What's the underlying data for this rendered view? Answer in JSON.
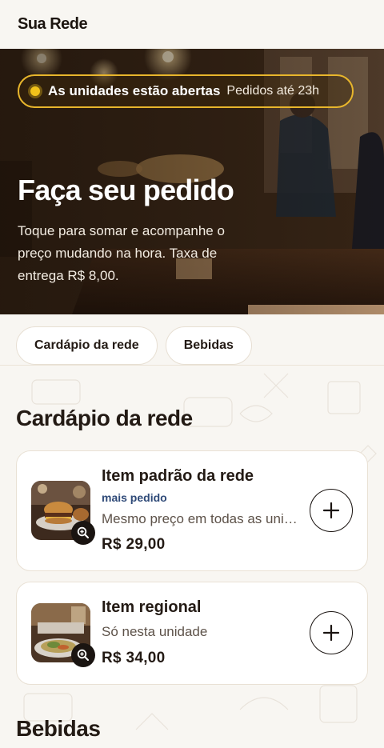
{
  "header": {
    "brand": "Sua Rede"
  },
  "hero": {
    "status_strong": "As unidades estão abertas",
    "status_soft": "Pedidos até 23h",
    "title": "Faça seu pedido",
    "description": "Toque para somar e acompanhe o preço mudando na hora. Taxa de entrega R$ 8,00.",
    "image": "bakery-counter-photo"
  },
  "tabs": [
    {
      "label": "Cardápio da rede"
    },
    {
      "label": "Bebidas"
    }
  ],
  "sections": [
    {
      "title": "Cardápio da rede",
      "items": [
        {
          "name": "Item padrão da rede",
          "tag": "mais pedido",
          "description": "Mesmo preço em todas as unidades",
          "price": "R$ 29,00",
          "image": "burger-photo",
          "zoom_icon": "zoom-in-icon",
          "add_icon": "plus-icon"
        },
        {
          "name": "Item regional",
          "tag": "",
          "description": "Só nesta unidade",
          "price": "R$ 34,00",
          "image": "dish-photo",
          "zoom_icon": "zoom-in-icon",
          "add_icon": "plus-icon"
        }
      ]
    },
    {
      "title": "Bebidas",
      "items": []
    }
  ],
  "colors": {
    "accent": "#e8b62c",
    "status_dot": "#f1c21b",
    "tag": "#2f4a78",
    "background": "#f8f6f2",
    "text": "#231a14"
  }
}
